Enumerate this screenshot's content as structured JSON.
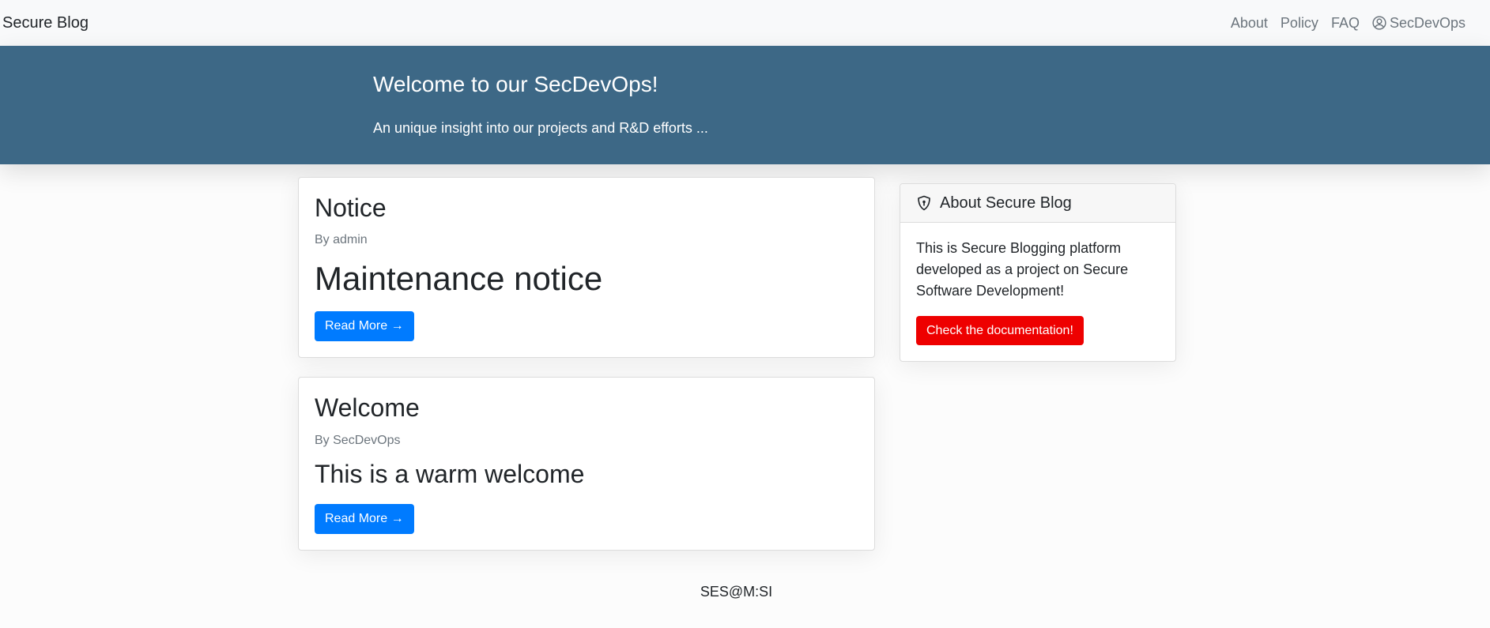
{
  "navbar": {
    "brand": "Secure Blog",
    "links": [
      {
        "label": "About"
      },
      {
        "label": "Policy"
      },
      {
        "label": "FAQ"
      },
      {
        "label": "SecDevOps",
        "icon": "user-circle-icon"
      }
    ]
  },
  "hero": {
    "title": "Welcome to our SecDevOps!",
    "subtitle": "An unique insight into our projects and R&D efforts ..."
  },
  "posts": [
    {
      "title": "Notice",
      "author": "By admin",
      "summary": "Maintenance notice",
      "button": "Read More →"
    },
    {
      "title": "Welcome",
      "author": "By SecDevOps",
      "summary": "This is a warm welcome",
      "button": "Read More →"
    }
  ],
  "sidebar": {
    "icon": "shield-icon",
    "title": "About Secure Blog",
    "body": "This is Secure Blogging platform developed as a project on Secure Software Development!",
    "button": "Check the documentation!"
  },
  "footer": {
    "text": "SES@M:SI"
  },
  "colors": {
    "hero_bg": "#3d6886",
    "primary_button": "#007bff",
    "danger_button": "#ee0000"
  }
}
